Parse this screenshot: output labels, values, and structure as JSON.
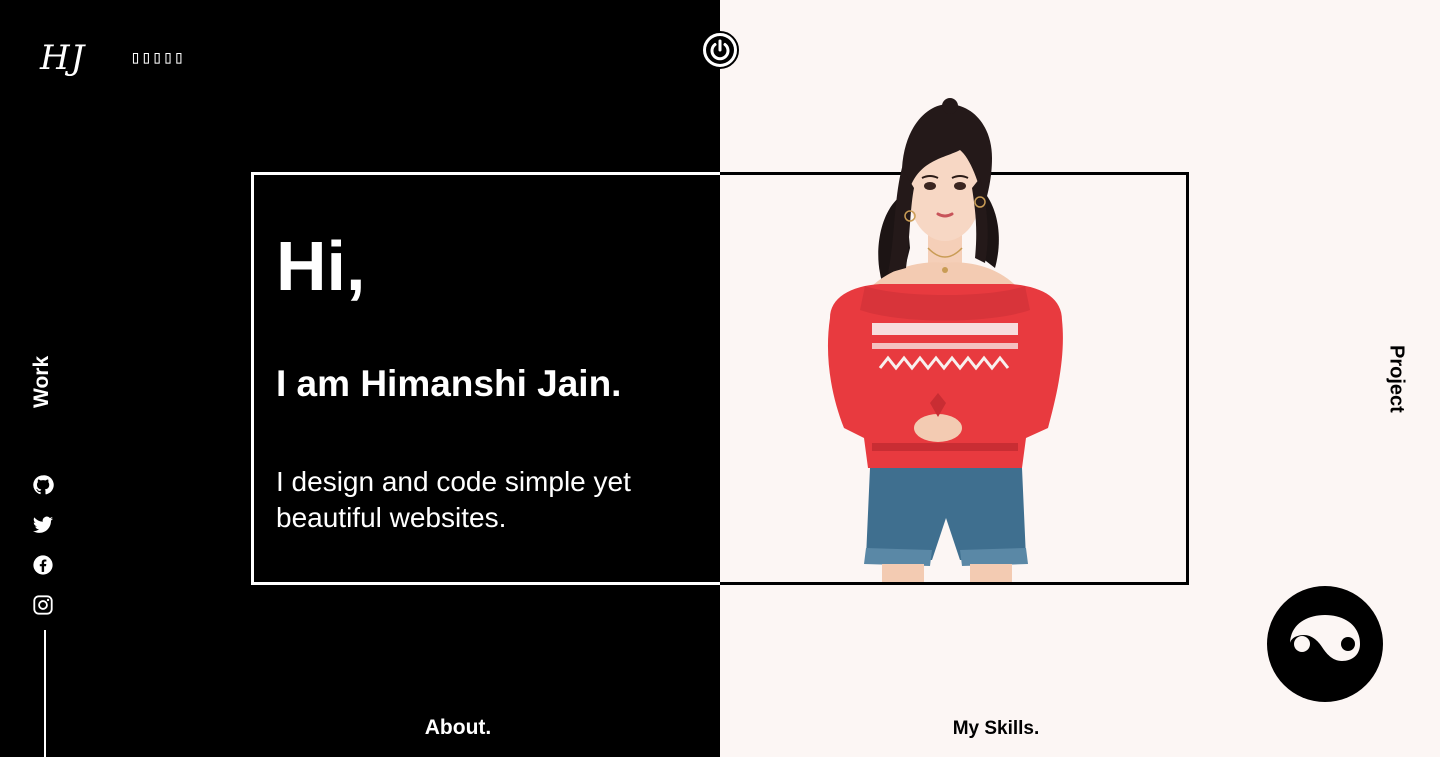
{
  "header": {
    "logo_text": "HJ",
    "tofu_text": "▯▯▯▯▯",
    "power_icon": "power-icon"
  },
  "nav": {
    "work_label": "Work",
    "project_label": "Project",
    "about_label": "About.",
    "skills_label": "My Skills."
  },
  "socials": [
    {
      "name": "github-icon"
    },
    {
      "name": "twitter-icon"
    },
    {
      "name": "facebook-icon"
    },
    {
      "name": "instagram-icon"
    }
  ],
  "intro": {
    "greeting": "Hi,",
    "name_line": "I am Himanshi Jain.",
    "tagline": "I design and code simple yet beautiful websites."
  },
  "colors": {
    "dark": "#000000",
    "light": "#fcf6f4",
    "sweater": "#e83a3f"
  },
  "portrait_icon": "portrait-illustration",
  "theme_toggle_icon": "yin-yang-icon"
}
